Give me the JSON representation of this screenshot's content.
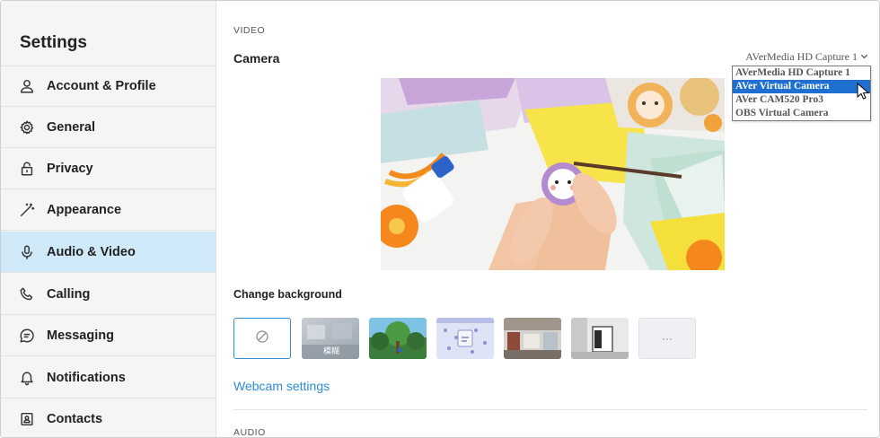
{
  "sidebar": {
    "title": "Settings",
    "items": [
      {
        "label": "Account & Profile",
        "icon": "person-icon"
      },
      {
        "label": "General",
        "icon": "gear-icon"
      },
      {
        "label": "Privacy",
        "icon": "lock-icon"
      },
      {
        "label": "Appearance",
        "icon": "magic-wand-icon"
      },
      {
        "label": "Audio & Video",
        "icon": "microphone-icon",
        "active": true
      },
      {
        "label": "Calling",
        "icon": "phone-icon"
      },
      {
        "label": "Messaging",
        "icon": "chat-icon"
      },
      {
        "label": "Notifications",
        "icon": "bell-icon"
      },
      {
        "label": "Contacts",
        "icon": "contacts-icon"
      }
    ]
  },
  "video": {
    "section_label": "VIDEO",
    "camera_label": "Camera",
    "camera_selected": "AVerMedia HD Capture 1",
    "camera_options": [
      "AVerMedia HD Capture 1",
      "AVer Virtual Camera",
      "AVer CAM520 Pro3",
      "OBS Virtual Camera"
    ],
    "highlighted_option": "AVer Virtual Camera",
    "change_background_label": "Change background",
    "background_blur_label": "模糊",
    "more_backgrounds_label": "···",
    "webcam_settings_link": "Webcam settings"
  },
  "audio": {
    "section_label": "AUDIO"
  },
  "colors": {
    "active_nav_bg": "#cfe9f8",
    "sidebar_bg": "#f5f5f5",
    "link": "#2d8cd3",
    "dropdown_highlight": "#1e6fd0"
  }
}
